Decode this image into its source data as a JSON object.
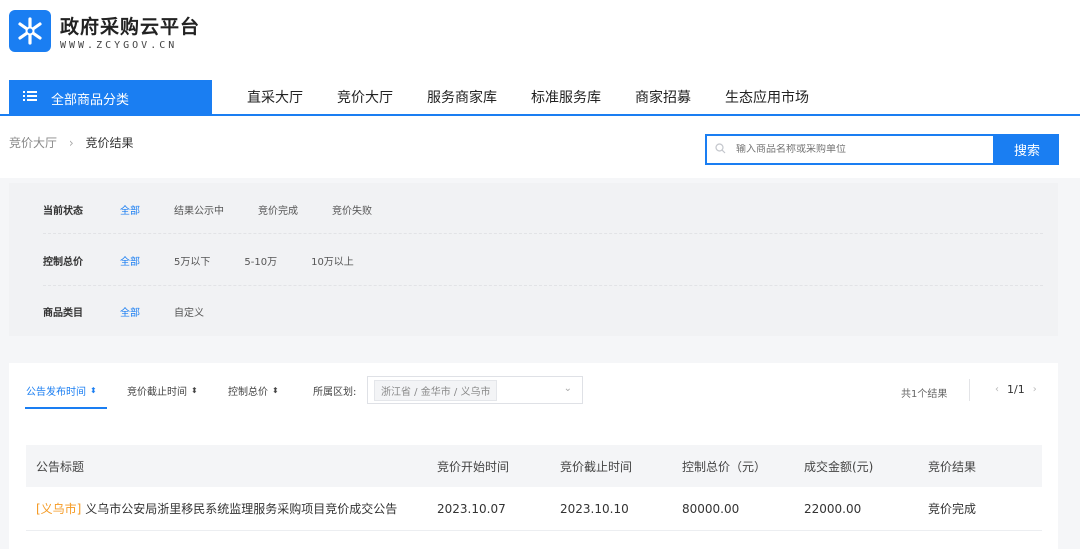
{
  "brand": {
    "title": "政府采购云平台",
    "subtitle": "WWW.ZCYGOV.CN",
    "accent": "#1a7ef2"
  },
  "nav": {
    "category_button": "全部商品分类",
    "items": [
      "直采大厅",
      "竞价大厅",
      "服务商家库",
      "标准服务库",
      "商家招募",
      "生态应用市场"
    ]
  },
  "breadcrumb": {
    "parent": "竞价大厅",
    "current": "竞价结果"
  },
  "search": {
    "placeholder": "输入商品名称或采购单位",
    "button": "搜索"
  },
  "filters": [
    {
      "label": "当前状态",
      "options": [
        "全部",
        "结果公示中",
        "竞价完成",
        "竞价失败"
      ],
      "selected": "全部"
    },
    {
      "label": "控制总价",
      "options": [
        "全部",
        "5万以下",
        "5-10万",
        "10万以上"
      ],
      "selected": "全部"
    },
    {
      "label": "商品类目",
      "options": [
        "全部",
        "自定义"
      ],
      "selected": "全部"
    }
  ],
  "sortbar": {
    "items": [
      "公告发布时间",
      "竞价截止时间",
      "控制总价"
    ],
    "region_label": "所属区划:",
    "region_value": "浙江省 / 金华市 / 义乌市",
    "total": "共1个结果",
    "page": "1/1"
  },
  "table": {
    "columns": [
      "公告标题",
      "竞价开始时间",
      "竞价截止时间",
      "控制总价（元）",
      "成交金额(元)",
      "竞价结果"
    ],
    "rows": [
      {
        "tag": "[义乌市]",
        "title": "义乌市公安局浙里移民系统监理服务采购项目竞价成交公告",
        "start": "2023.10.07",
        "end": "2023.10.10",
        "budget": "80000.00",
        "deal": "22000.00",
        "result": "竞价完成"
      }
    ]
  }
}
